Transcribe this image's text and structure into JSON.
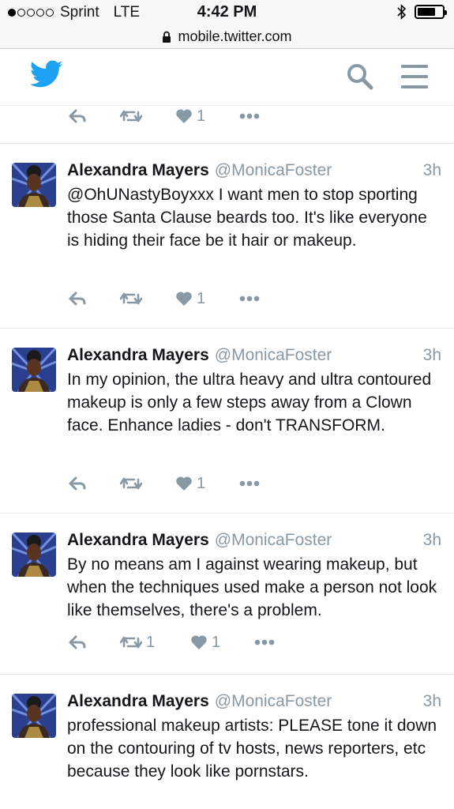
{
  "status_bar": {
    "carrier": "Sprint",
    "network": "LTE",
    "time": "4:42 PM"
  },
  "url_bar": {
    "url": "mobile.twitter.com"
  },
  "header": {
    "logo_icon": "twitter-bird-icon",
    "search_icon": "search-icon",
    "menu_icon": "menu-icon"
  },
  "colors": {
    "brand": "#1da1f2",
    "muted": "#8899a6",
    "text": "#14171a"
  },
  "previous_tweet": {
    "like_count": "1"
  },
  "tweets": [
    {
      "name": "Alexandra Mayers",
      "handle": "@MonicaFoster",
      "time": "3h",
      "text": "@OhUNastyBoyxxx I want men to stop sporting those Santa Clause beards too. It's like everyone is hiding their face be it hair or makeup.",
      "retweet_count": "",
      "like_count": "1"
    },
    {
      "name": "Alexandra Mayers",
      "handle": "@MonicaFoster",
      "time": "3h",
      "text": "In my opinion, the ultra heavy and ultra contoured makeup is only a few steps away from a Clown face. Enhance ladies - don't TRANSFORM.",
      "retweet_count": "",
      "like_count": "1"
    },
    {
      "name": "Alexandra Mayers",
      "handle": "@MonicaFoster",
      "time": "3h",
      "text": "By no means am I against wearing makeup, but when the techniques used make a person not look like themselves, there's a problem.",
      "retweet_count": "1",
      "like_count": "1"
    },
    {
      "name": "Alexandra Mayers",
      "handle": "@MonicaFoster",
      "time": "3h",
      "text": "professional makeup artists: PLEASE tone it down on the contouring of tv hosts, news reporters, etc because they look like pornstars.",
      "retweet_count": "",
      "like_count": ""
    }
  ]
}
